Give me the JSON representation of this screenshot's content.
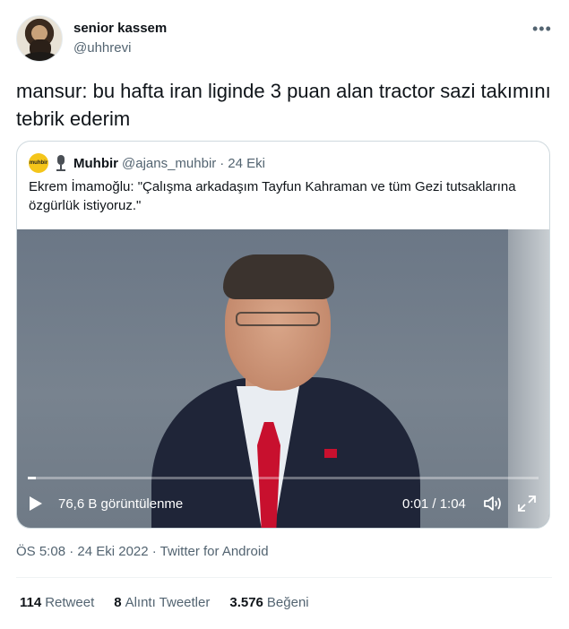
{
  "author": {
    "display_name": "senior kassem",
    "handle": "@uhhrevi"
  },
  "more_icon": "more-horizontal-icon",
  "tweet_text": "mansur: bu hafta iran liginde 3 puan alan tractor sazi takımını tebrik ederim",
  "quoted": {
    "logo_text": "muhbir",
    "name": "Muhbir",
    "handle": "@ajans_muhbir",
    "separator": "·",
    "date": "24 Eki",
    "text": "Ekrem İmamoğlu: \"Çalışma arkadaşım Tayfun Kahraman ve tüm Gezi tutsaklarına özgürlük istiyoruz.\"",
    "video": {
      "views": "76,6 B görüntülenme",
      "time": "0:01 / 1:04",
      "progress": 0.016
    }
  },
  "meta": "ÖS 5:08 · 24 Eki 2022 · Twitter for Android",
  "stats": {
    "retweets_count": "114",
    "retweets_label": "Retweet",
    "quotes_count": "8",
    "quotes_label": "Alıntı Tweetler",
    "likes_count": "3.576",
    "likes_label": "Beğeni"
  },
  "colors": {
    "text": "#0f1419",
    "secondary": "#536471",
    "border": "#cfd9de",
    "muhbir_yellow": "#f4c51a"
  }
}
